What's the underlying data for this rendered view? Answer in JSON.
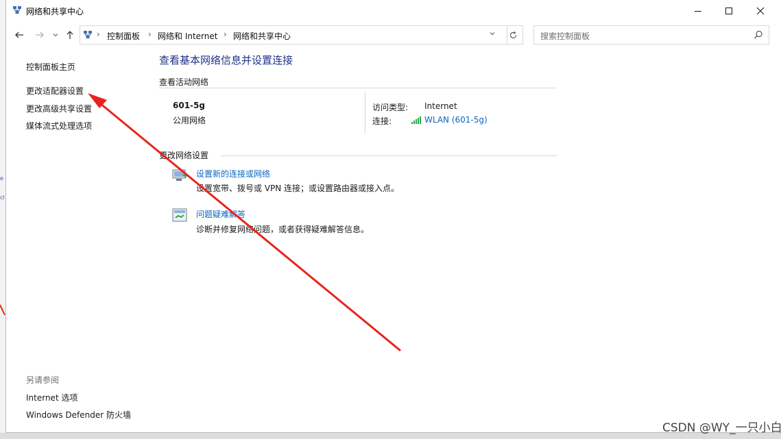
{
  "window": {
    "title": "网络和共享中心"
  },
  "address": {
    "crumbs": [
      "控制面板",
      "网络和 Internet",
      "网络和共享中心"
    ]
  },
  "search": {
    "placeholder": "搜索控制面板"
  },
  "left_pane": {
    "links": [
      "控制面板主页",
      "更改适配器设置",
      "更改高级共享设置",
      "媒体流式处理选项"
    ],
    "see_also_title": "另请参阅",
    "see_also_links": [
      "Internet 选项",
      "Windows Defender 防火墙"
    ]
  },
  "main": {
    "title": "查看基本网络信息并设置连接",
    "active_networks_title": "查看活动网络",
    "network": {
      "name": "601-5g",
      "category": "公用网络",
      "access_label": "访问类型:",
      "access_value": "Internet",
      "connection_label": "连接:",
      "connection_value": "WLAN (601-5g)"
    },
    "change_settings_title": "更改网络设置",
    "tasks": [
      {
        "title": "设置新的连接或网络",
        "desc": "设置宽带、拨号或 VPN 连接；或设置路由器或接入点。"
      },
      {
        "title": "问题疑难解答",
        "desc": "诊断并修复网络问题，或者获得疑难解答信息。"
      }
    ]
  },
  "watermark": "CSDN @WY_一只小白",
  "colors": {
    "title_blue": "#1e3287",
    "link_blue": "#0a66c2",
    "annotation_red": "#e8231d"
  }
}
